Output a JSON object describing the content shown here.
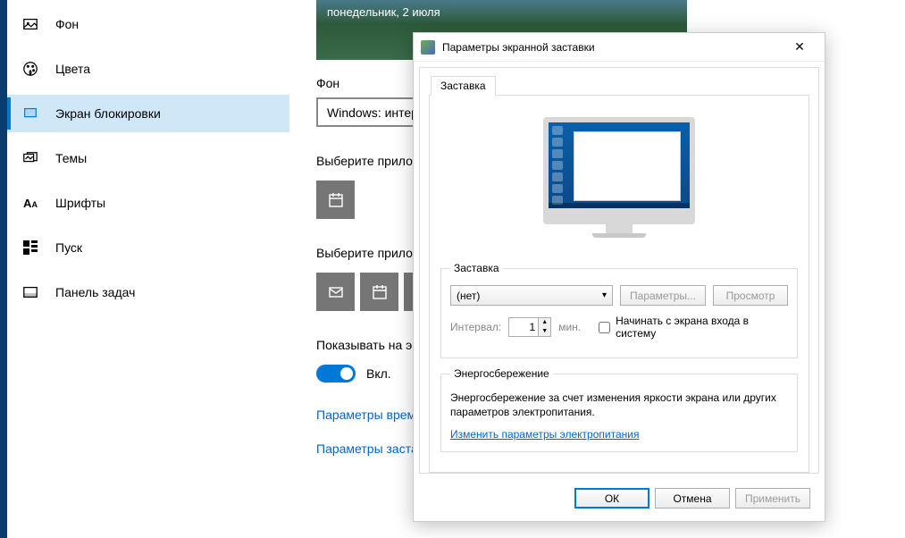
{
  "sidebar": {
    "items": [
      {
        "label": "Фон"
      },
      {
        "label": "Цвета"
      },
      {
        "label": "Экран блокировки"
      },
      {
        "label": "Темы"
      },
      {
        "label": "Шрифты"
      },
      {
        "label": "Пуск"
      },
      {
        "label": "Панель задач"
      }
    ]
  },
  "main": {
    "preview_date": "понедельник, 2 июля",
    "bg_label": "Фон",
    "bg_value": "Windows: интересное",
    "app1_desc": "Выберите приложение для вывода подробные сведений о состоянии",
    "app2_desc": "Выберите приложения, сведения о состоянии которых будут отображаться",
    "show_tip": "Показывать на экране входа фоновый рисунок экрана блокировки",
    "toggle_label": "Вкл.",
    "link_timeout": "Параметры времени ожидания для экрана",
    "link_saver": "Параметры заставки"
  },
  "dialog": {
    "title": "Параметры экранной заставки",
    "tab_label": "Заставка",
    "saver_group": "Заставка",
    "combo_value": "(нет)",
    "btn_params": "Параметры...",
    "btn_preview": "Просмотр",
    "interval_label": "Интервал:",
    "interval_value": "1",
    "interval_unit": "мин.",
    "chk_label": "Начинать с экрана входа в систему",
    "power_group": "Энергосбережение",
    "power_text": "Энергосбережение за счет изменения яркости экрана или других параметров электропитания.",
    "power_link": "Изменить параметры электропитания",
    "btn_ok": "ОК",
    "btn_cancel": "Отмена",
    "btn_apply": "Применить"
  }
}
